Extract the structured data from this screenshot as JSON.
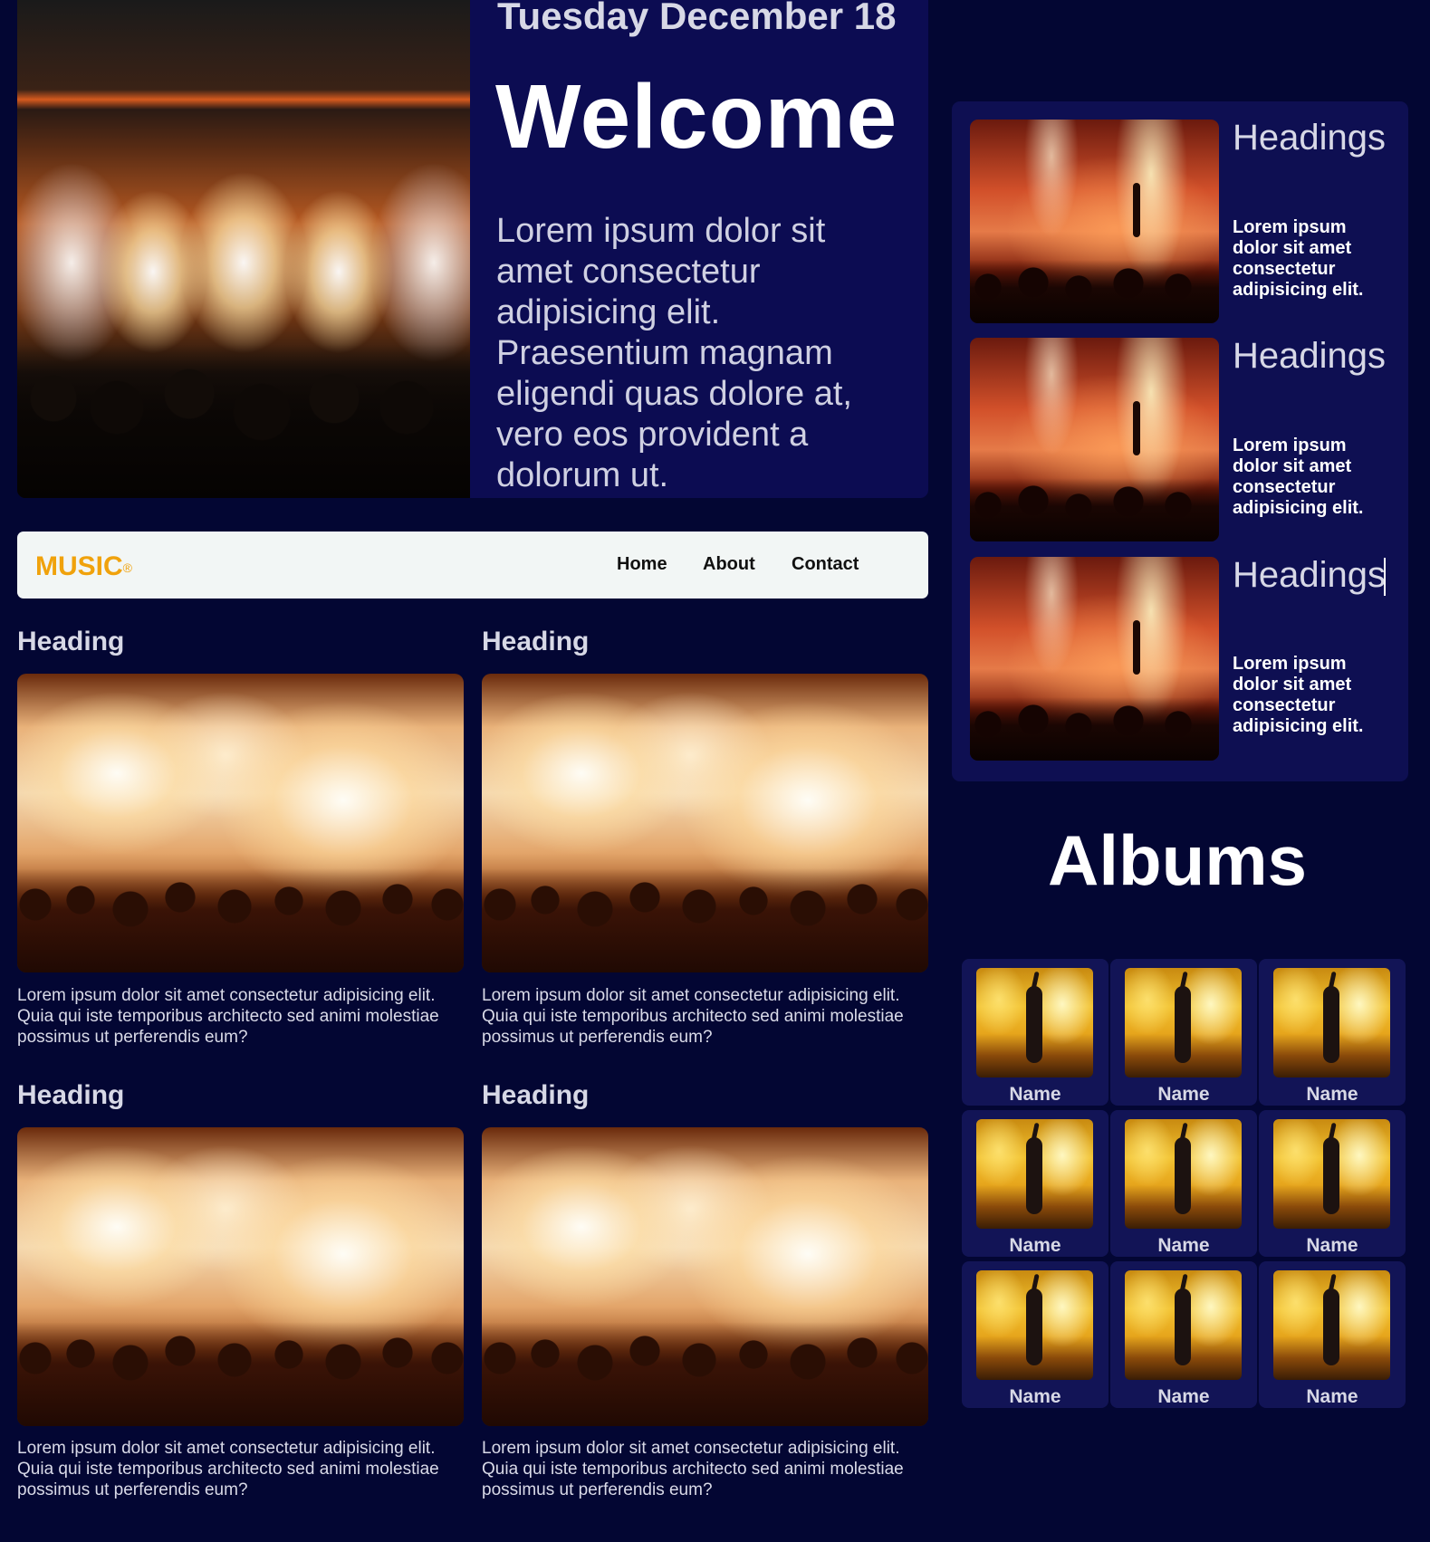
{
  "hero": {
    "date": "Tuesday December 18",
    "title": "Welcome",
    "text": "Lorem ipsum dolor sit amet consectetur adipisicing elit. Praesentium magnam eligendi quas dolore at, vero eos provident a dolorum ut."
  },
  "nav": {
    "brand": "MUSIC",
    "brand_mark": "®",
    "links": [
      "Home",
      "About",
      "Contact"
    ]
  },
  "cards": [
    {
      "heading": "Heading",
      "text": "Lorem ipsum dolor sit amet consectetur adipisicing elit. Quia qui iste temporibus architecto sed animi molestiae possimus ut perferendis eum?"
    },
    {
      "heading": "Heading",
      "text": "Lorem ipsum dolor sit amet consectetur adipisicing elit. Quia qui iste temporibus architecto sed animi molestiae possimus ut perferendis eum?"
    },
    {
      "heading": "Heading",
      "text": "Lorem ipsum dolor sit amet consectetur adipisicing elit. Quia qui iste temporibus architecto sed animi molestiae possimus ut perferendis eum?"
    },
    {
      "heading": "Heading",
      "text": "Lorem ipsum dolor sit amet consectetur adipisicing elit. Quia qui iste temporibus architecto sed animi molestiae possimus ut perferendis eum?"
    }
  ],
  "sidebar": {
    "items": [
      {
        "heading": "Headings",
        "text": "Lorem ipsum dolor sit amet consectetur adipisicing elit."
      },
      {
        "heading": "Headings",
        "text": "Lorem ipsum dolor sit amet consectetur adipisicing elit."
      },
      {
        "heading": "Headings",
        "text": "Lorem ipsum dolor sit amet consectetur adipisicing elit."
      }
    ]
  },
  "albums": {
    "title": "Albums",
    "items": [
      {
        "name": "Name"
      },
      {
        "name": "Name"
      },
      {
        "name": "Name"
      },
      {
        "name": "Name"
      },
      {
        "name": "Name"
      },
      {
        "name": "Name"
      },
      {
        "name": "Name"
      },
      {
        "name": "Name"
      },
      {
        "name": "Name"
      }
    ]
  },
  "colors": {
    "page_background": "#030633",
    "panel_background": "#0c0c52",
    "brand": "#f0a20c",
    "navbar_background": "#f2f6f5"
  }
}
